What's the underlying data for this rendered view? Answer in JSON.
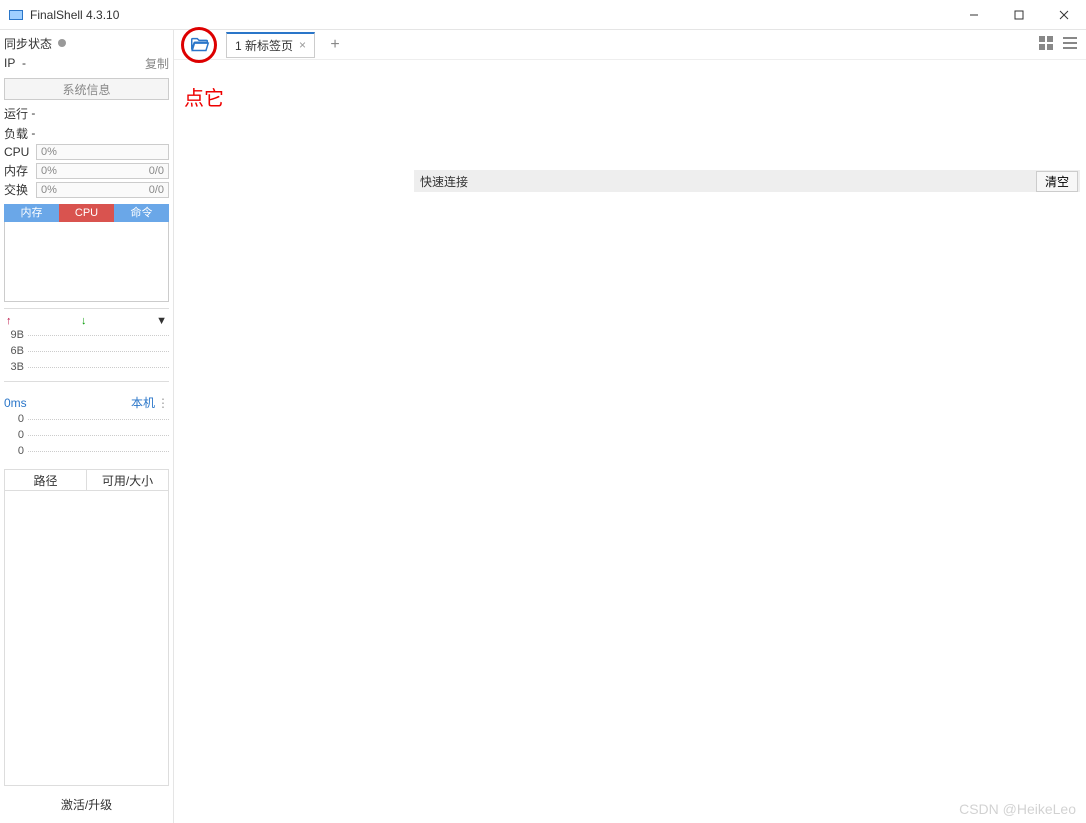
{
  "window": {
    "title": "FinalShell 4.3.10"
  },
  "sidebar": {
    "sync_status_label": "同步状态",
    "ip_label": "IP",
    "ip_value": "-",
    "copy_label": "复制",
    "sysinfo_button": "系统信息",
    "running_label": "运行",
    "running_value": "-",
    "load_label": "负载",
    "load_value": "-",
    "cpu_label": "CPU",
    "cpu_value": "0%",
    "mem_label": "内存",
    "mem_value": "0%",
    "mem_frac": "0/0",
    "swap_label": "交换",
    "swap_value": "0%",
    "swap_frac": "0/0",
    "subtabs": {
      "mem": "内存",
      "cpu": "CPU",
      "cmd": "命令"
    },
    "spark_labels": [
      "9B",
      "6B",
      "3B"
    ],
    "latency_value": "0ms",
    "latency_host": "本机",
    "latency_marks": [
      "0",
      "0",
      "0"
    ],
    "disk_cols": {
      "path": "路径",
      "avail": "可用/大小"
    },
    "footer": "激活/升级"
  },
  "main": {
    "tab_label": "1 新标签页",
    "quick_connect_label": "快速连接",
    "clear_button": "清空"
  },
  "annotation": {
    "text": "点它"
  },
  "watermark": "CSDN @HeikeLeo"
}
